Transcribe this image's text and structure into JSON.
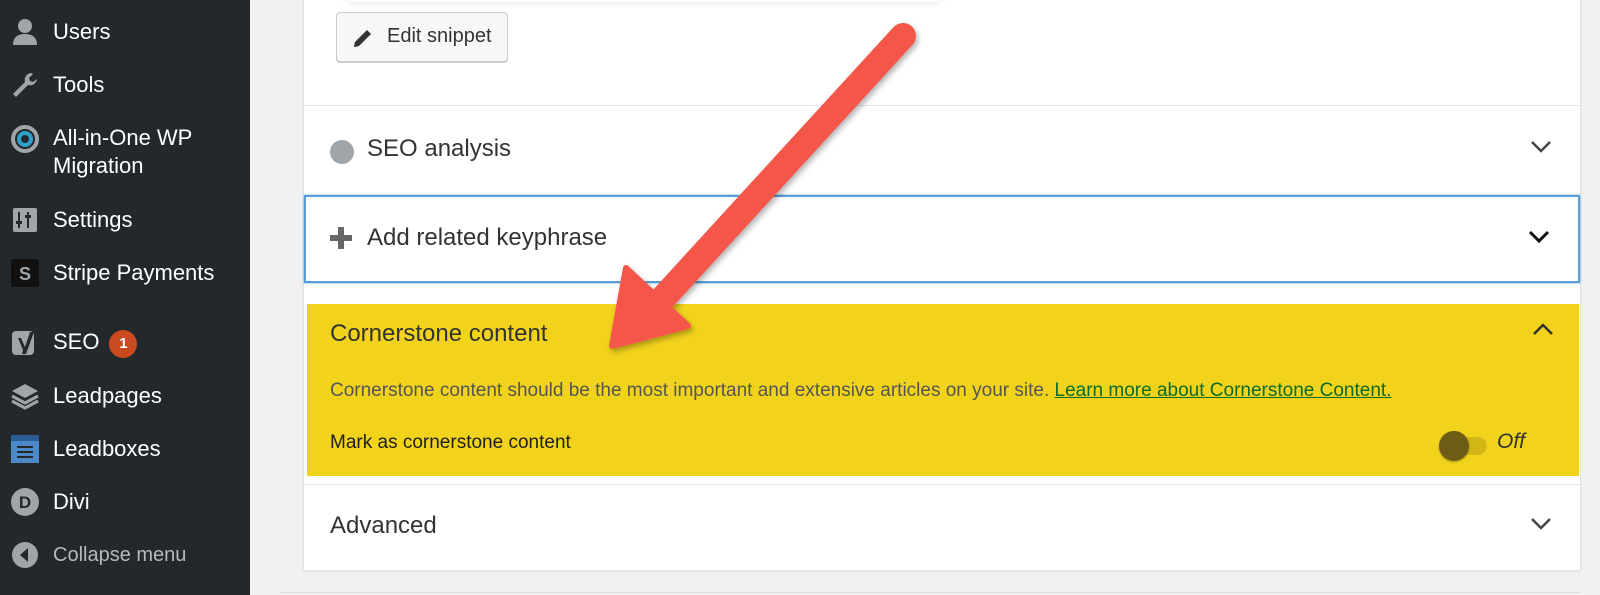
{
  "sidebar": {
    "items": [
      {
        "label": "Users",
        "icon": "user-icon"
      },
      {
        "label": "Tools",
        "icon": "wrench-icon"
      },
      {
        "label": "All-in-One WP",
        "label2": "Migration",
        "icon": "migration-icon"
      },
      {
        "label": "Settings",
        "icon": "settings-icon"
      },
      {
        "label": "Stripe Payments",
        "icon": "stripe-icon"
      },
      {
        "label": "SEO",
        "badge": "1",
        "icon": "yoast-icon"
      },
      {
        "label": "Leadpages",
        "icon": "layers-icon"
      },
      {
        "label": "Leadboxes",
        "icon": "leadboxes-icon"
      },
      {
        "label": "Divi",
        "icon": "divi-icon"
      },
      {
        "label": "Collapse menu",
        "icon": "collapse-icon"
      }
    ]
  },
  "snippet": {
    "edit_label": "Edit snippet"
  },
  "sections": {
    "seo_analysis": "SEO analysis",
    "related": "Add related keyphrase",
    "cornerstone": {
      "title": "Cornerstone content",
      "description": "Cornerstone content should be the most important and extensive articles on your site. ",
      "link": "Learn more about Cornerstone Content.",
      "mark_label": "Mark as cornerstone content",
      "toggle_state": "Off"
    },
    "advanced": "Advanced"
  },
  "colors": {
    "sidebar_bg": "#23282d",
    "highlight": "#f2d31c",
    "arrow": "#f4574a",
    "badge": "#ca4a1f",
    "focus_border": "#5b9dd9"
  }
}
